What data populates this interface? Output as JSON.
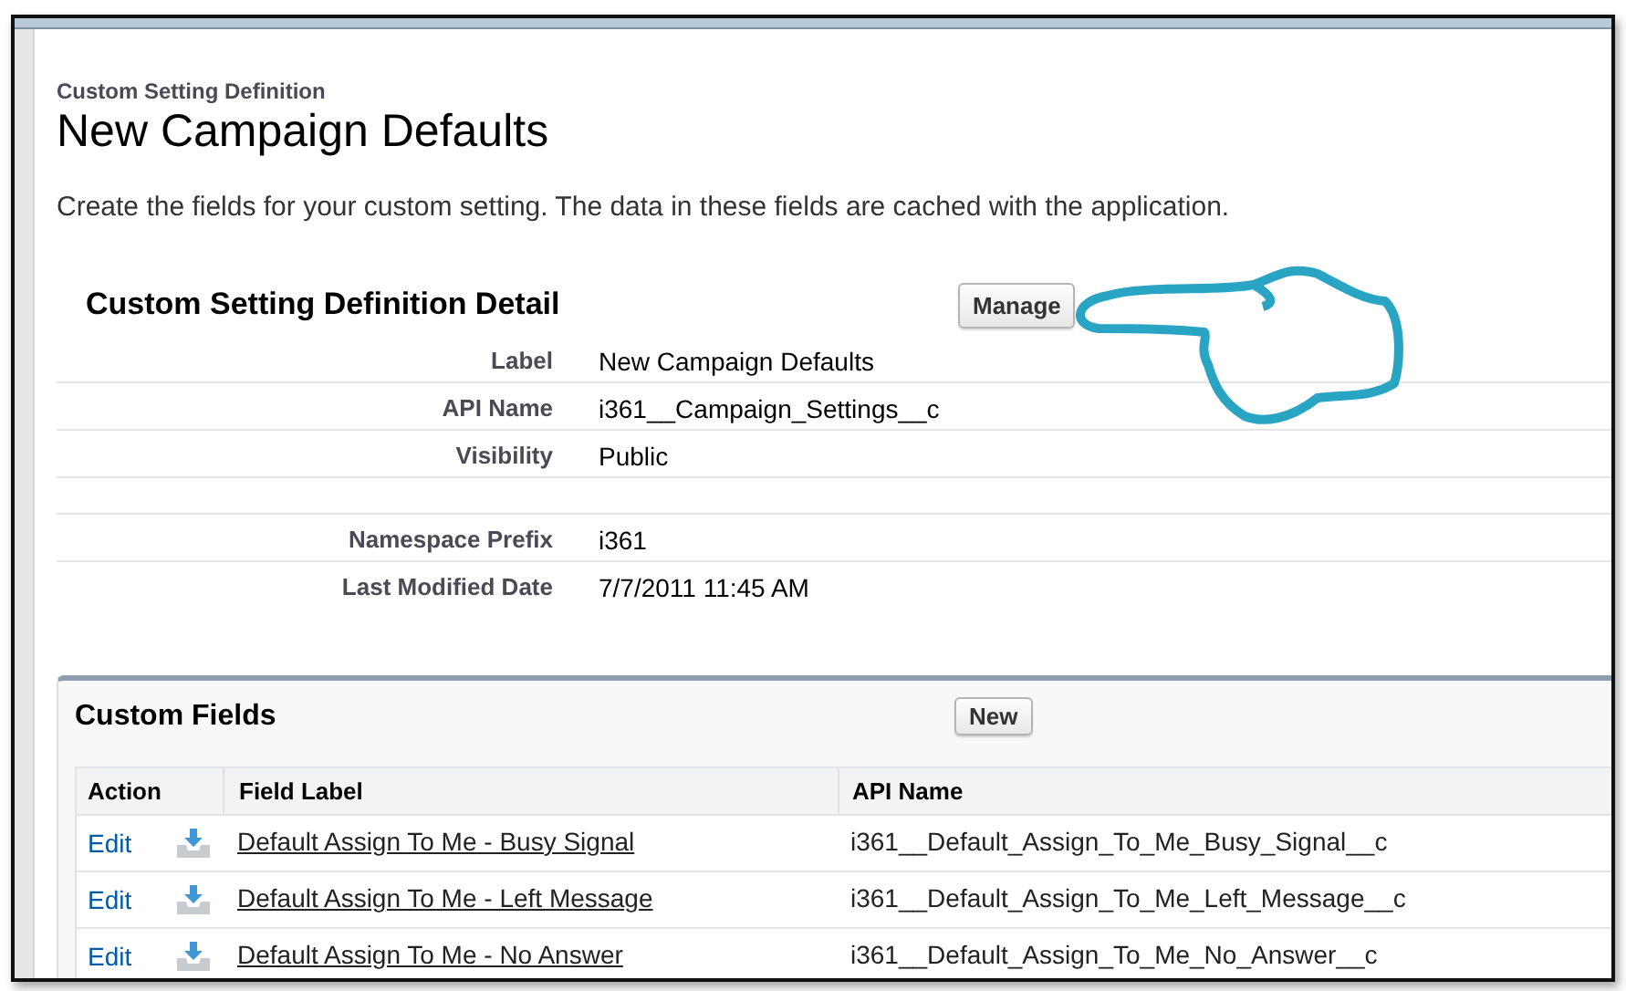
{
  "breadcrumb": "Custom Setting Definition",
  "title": "New Campaign Defaults",
  "description": "Create the fields for your custom setting. The data in these fields are cached with the application.",
  "detail": {
    "heading": "Custom Setting Definition Detail",
    "button": "Manage",
    "rows": [
      {
        "label": "Label",
        "value": "New Campaign Defaults"
      },
      {
        "label": "API Name",
        "value": "i361__Campaign_Settings__c"
      },
      {
        "label": "Visibility",
        "value": "Public"
      },
      {
        "kind": "spacer"
      },
      {
        "label": "Namespace Prefix",
        "value": "i361"
      },
      {
        "label": "Last Modified Date",
        "value": "7/7/2011 11:45 AM"
      }
    ]
  },
  "custom_fields": {
    "heading": "Custom Fields",
    "button": "New",
    "columns": [
      "Action",
      "Field Label",
      "API Name"
    ],
    "rows": [
      {
        "action": "Edit",
        "field_label": "Default Assign To Me - Busy Signal",
        "api_name": "i361__Default_Assign_To_Me_Busy_Signal__c"
      },
      {
        "action": "Edit",
        "field_label": "Default Assign To Me - Left Message",
        "api_name": "i361__Default_Assign_To_Me_Left_Message__c"
      },
      {
        "action": "Edit",
        "field_label": "Default Assign To Me - No Answer",
        "api_name": "i361__Default_Assign_To_Me_No_Answer__c"
      }
    ]
  }
}
